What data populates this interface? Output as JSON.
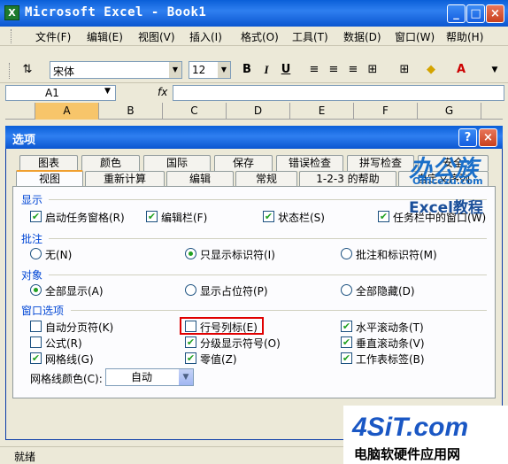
{
  "window": {
    "title": "Microsoft Excel - Book1",
    "app_icon": "X",
    "minimize": "_",
    "maximize": "□",
    "close": "×"
  },
  "menu": [
    "文件(F)",
    "编辑(E)",
    "视图(V)",
    "插入(I)",
    "格式(O)",
    "工具(T)",
    "数据(D)",
    "窗口(W)",
    "帮助(H)"
  ],
  "toolbar": {
    "font": "宋体",
    "size": "12",
    "bold": "B",
    "italic": "I",
    "underline": "U"
  },
  "formula": {
    "cell": "A1",
    "fx": "fx"
  },
  "columns": [
    "A",
    "B",
    "C",
    "D",
    "E",
    "F",
    "G"
  ],
  "dialog": {
    "title": "选项",
    "help": "?",
    "close": "×",
    "tabs_back": [
      "图表",
      "颜色",
      "国际",
      "保存",
      "错误检查",
      "拼写检查",
      "安全"
    ],
    "tabs_front": [
      "视图",
      "重新计算",
      "编辑",
      "常规",
      "1-2-3 的帮助",
      "自定义序列"
    ],
    "active_tab": "视图",
    "sections": {
      "show": {
        "title": "显示",
        "items": [
          {
            "label": "启动任务窗格(R)",
            "checked": true
          },
          {
            "label": "编辑栏(F)",
            "checked": true
          },
          {
            "label": "状态栏(S)",
            "checked": true
          },
          {
            "label": "任务栏中的窗口(W)",
            "checked": true
          }
        ]
      },
      "comments": {
        "title": "批注",
        "items": [
          {
            "label": "无(N)",
            "selected": false
          },
          {
            "label": "只显示标识符(I)",
            "selected": true
          },
          {
            "label": "批注和标识符(M)",
            "selected": false
          }
        ]
      },
      "objects": {
        "title": "对象",
        "items": [
          {
            "label": "全部显示(A)",
            "selected": true
          },
          {
            "label": "显示占位符(P)",
            "selected": false
          },
          {
            "label": "全部隐藏(D)",
            "selected": false
          }
        ]
      },
      "window_options": {
        "title": "窗口选项",
        "col1": [
          {
            "label": "自动分页符(K)",
            "checked": false
          },
          {
            "label": "公式(R)",
            "checked": false
          },
          {
            "label": "网格线(G)",
            "checked": true
          }
        ],
        "col2": [
          {
            "label": "行号列标(E)",
            "checked": false
          },
          {
            "label": "分级显示符号(O)",
            "checked": true
          },
          {
            "label": "零值(Z)",
            "checked": true
          }
        ],
        "col3": [
          {
            "label": "水平滚动条(T)",
            "checked": true
          },
          {
            "label": "垂直滚动条(V)",
            "checked": true
          },
          {
            "label": "工作表标签(B)",
            "checked": true
          }
        ],
        "gridline_color_label": "网格线颜色(C):",
        "gridline_color_value": "自动"
      }
    }
  },
  "status": "就绪",
  "watermarks": {
    "top": "办公族",
    "top_sub": "Officezu.com",
    "excel": "Excel教程",
    "site": "4SiT.com",
    "site_sub": "电脑软硬件应用网"
  },
  "colors": {
    "accent_title": "#0a5fd8",
    "check": "#21a121",
    "highlight": "#e00000"
  }
}
